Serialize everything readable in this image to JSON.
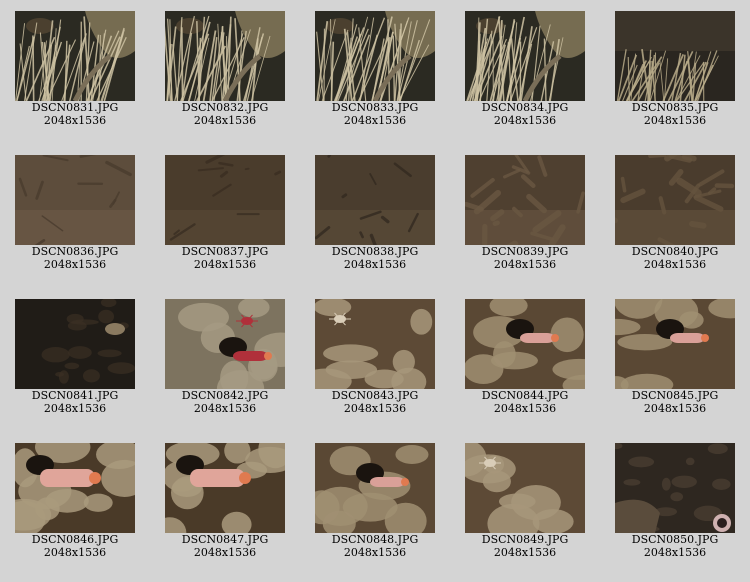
{
  "gallery": {
    "items": [
      {
        "filename": "DSCN0831.JPG",
        "dimensions": "2048x1536",
        "scene": "grass",
        "colors": [
          "#2b2a22",
          "#8a7d5e",
          "#cfc3a3"
        ]
      },
      {
        "filename": "DSCN0832.JPG",
        "dimensions": "2048x1536",
        "scene": "grass",
        "colors": [
          "#2b2a22",
          "#8a7d5e",
          "#cfc3a3"
        ]
      },
      {
        "filename": "DSCN0833.JPG",
        "dimensions": "2048x1536",
        "scene": "grass",
        "colors": [
          "#2b2a22",
          "#8a7d5e",
          "#cfc3a3"
        ]
      },
      {
        "filename": "DSCN0834.JPG",
        "dimensions": "2048x1536",
        "scene": "grass",
        "colors": [
          "#2b2a22",
          "#8a7d5e",
          "#cfc3a3"
        ]
      },
      {
        "filename": "DSCN0835.JPG",
        "dimensions": "2048x1536",
        "scene": "grass-far",
        "colors": [
          "#2a2620",
          "#6f644c",
          "#b8ab8a"
        ]
      },
      {
        "filename": "DSCN0836.JPG",
        "dimensions": "2048x1536",
        "scene": "murky",
        "colors": [
          "#5d4d3c",
          "#6e5c47",
          "#4a3c2e"
        ]
      },
      {
        "filename": "DSCN0837.JPG",
        "dimensions": "2048x1536",
        "scene": "murky",
        "colors": [
          "#4a3c2c",
          "#5a4a37",
          "#3a2e22"
        ]
      },
      {
        "filename": "DSCN0838.JPG",
        "dimensions": "2048x1536",
        "scene": "murky",
        "colors": [
          "#4a3d2e",
          "#5e4e3b",
          "#332a20"
        ]
      },
      {
        "filename": "DSCN0839.JPG",
        "dimensions": "2048x1536",
        "scene": "branches",
        "colors": [
          "#4f4030",
          "#6a5742",
          "#3a2e22"
        ]
      },
      {
        "filename": "DSCN0840.JPG",
        "dimensions": "2048x1536",
        "scene": "branches",
        "colors": [
          "#4a3c2d",
          "#65533e",
          "#362b20"
        ]
      },
      {
        "filename": "DSCN0841.JPG",
        "dimensions": "2048x1536",
        "scene": "dark",
        "colors": [
          "#201c17",
          "#3a2f24",
          "#5a4a38"
        ]
      },
      {
        "filename": "DSCN0842.JPG",
        "dimensions": "2048x1536",
        "scene": "rock-worm",
        "colors": [
          "#7d735f",
          "#a59a82",
          "#b0303a"
        ]
      },
      {
        "filename": "DSCN0843.JPG",
        "dimensions": "2048x1536",
        "scene": "rock-crab",
        "colors": [
          "#5d4a36",
          "#a7977a",
          "#d9cdb8"
        ]
      },
      {
        "filename": "DSCN0844.JPG",
        "dimensions": "2048x1536",
        "scene": "rock-worm-pink",
        "colors": [
          "#5a4834",
          "#a08f72",
          "#d9a098"
        ]
      },
      {
        "filename": "DSCN0845.JPG",
        "dimensions": "2048x1536",
        "scene": "rock-worm-pink",
        "colors": [
          "#5a4834",
          "#a08f72",
          "#d9a098"
        ]
      },
      {
        "filename": "DSCN0846.JPG",
        "dimensions": "2048x1536",
        "scene": "worm-close",
        "colors": [
          "#4a3a28",
          "#a99a7c",
          "#e0a59a"
        ]
      },
      {
        "filename": "DSCN0847.JPG",
        "dimensions": "2048x1536",
        "scene": "worm-close",
        "colors": [
          "#4a3a28",
          "#a99a7c",
          "#e0a59a"
        ]
      },
      {
        "filename": "DSCN0848.JPG",
        "dimensions": "2048x1536",
        "scene": "rock-worm-pink",
        "colors": [
          "#5a4834",
          "#a08f72",
          "#d9a098"
        ]
      },
      {
        "filename": "DSCN0849.JPG",
        "dimensions": "2048x1536",
        "scene": "rock-crab",
        "colors": [
          "#5d4a36",
          "#a7977a",
          "#d9cdb8"
        ]
      },
      {
        "filename": "DSCN0850.JPG",
        "dimensions": "2048x1536",
        "scene": "dark-rock",
        "colors": [
          "#2e2720",
          "#4d4033",
          "#e0c0c0"
        ]
      }
    ]
  }
}
